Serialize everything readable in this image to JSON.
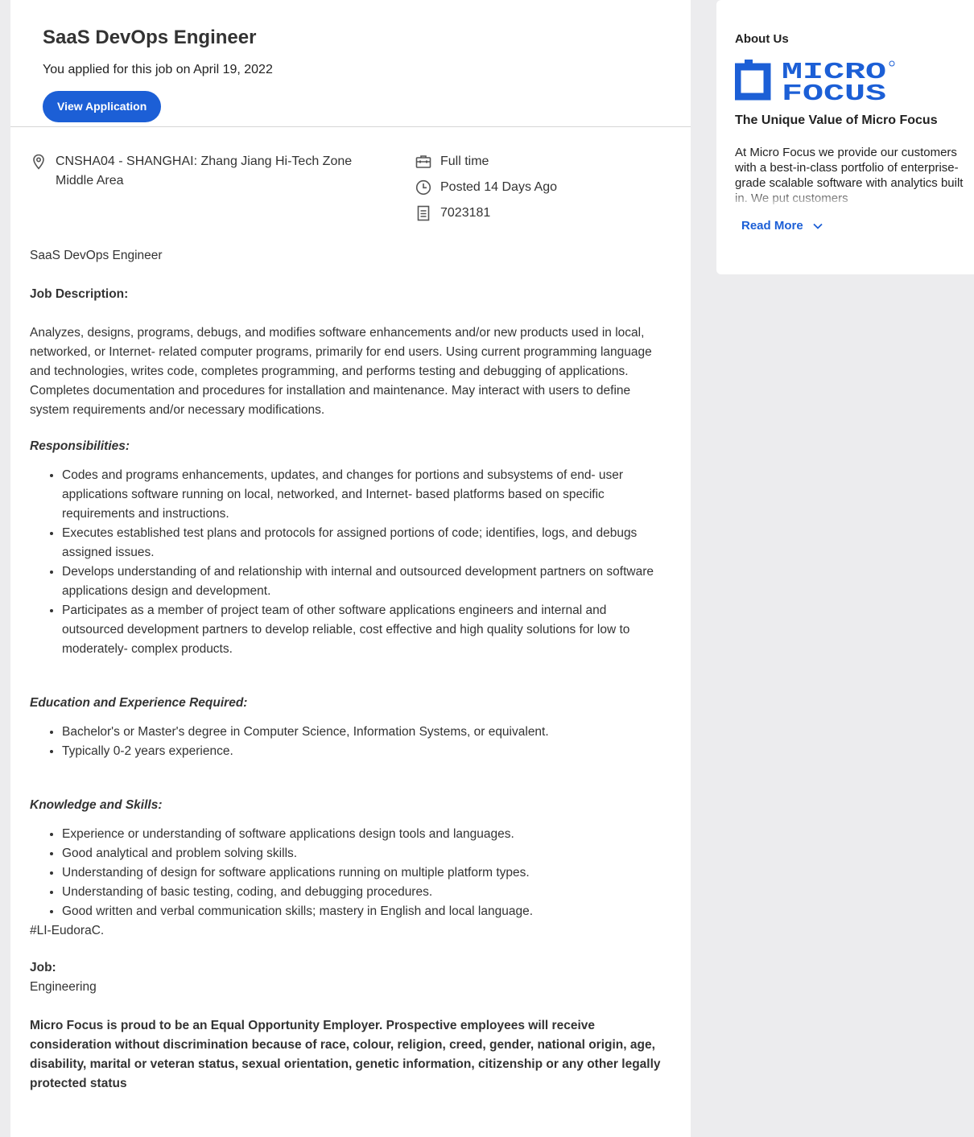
{
  "job": {
    "title": "SaaS DevOps Engineer",
    "applied_text": "You applied for this job on April 19, 2022",
    "view_button": "View Application",
    "location_line1": "CNSHA04 - SHANGHAI: Zhang Jiang Hi-Tech Zone",
    "location_line2": "Middle Area",
    "job_type": "Full time",
    "posted": "Posted 14 Days Ago",
    "req_id": "7023181"
  },
  "description": {
    "intro_title": "SaaS DevOps Engineer",
    "job_desc_label": "Job Description:",
    "job_desc_text": "Analyzes, designs, programs, debugs, and modifies software enhancements and/or new products used in local, networked, or Internet- related computer programs, primarily for end users. Using current programming language and technologies, writes code, completes programming, and performs testing and debugging of applications. Completes documentation and procedures for installation and maintenance. May interact with users to define system requirements and/or necessary modifications.",
    "responsibilities_label": "Responsibilities:",
    "responsibilities": [
      "Codes and programs enhancements, updates, and changes for portions and subsystems of end- user applications software running on local, networked, and Internet- based platforms based on specific requirements and instructions.",
      "Executes established test plans and protocols for assigned portions of code; identifies, logs, and debugs assigned issues.",
      "Develops understanding of and relationship with internal and outsourced development partners on software applications design and development.",
      "Participates as a member of project team of other software applications engineers and internal and outsourced development partners to develop reliable, cost effective and high quality solutions for low to moderately- complex products."
    ],
    "education_label": "Education and Experience Required:",
    "education": [
      "Bachelor's or Master's degree in Computer Science, Information Systems, or equivalent.",
      "Typically 0-2 years experience."
    ],
    "skills_label": "Knowledge and Skills:",
    "skills": [
      "Experience or understanding of software applications design tools and languages.",
      "Good analytical and problem solving skills.",
      "Understanding of design for software applications running on multiple platform types.",
      "Understanding of basic testing, coding, and debugging procedures.",
      "Good written and verbal communication skills; mastery in English and local language."
    ],
    "hashtag": "#LI-EudoraC.",
    "job_label": "Job:",
    "job_value": "Engineering",
    "eeo": "Micro Focus is proud to be an  Equal Opportunity Employer.  Prospective employees will receive consideration without discrimination because of race, colour, religion, creed, gender, national origin, age, disability, marital or veteran status, sexual orientation, genetic information, citizenship or any other legally protected status"
  },
  "sidebar": {
    "about_label": "About Us",
    "logo_text_line1": "MICRO",
    "logo_text_line2": "FOCUS",
    "value_title": "The Unique Value of Micro Focus",
    "about_text": "At Micro Focus we provide our customers with a best-in-class portfolio of enterprise-grade scalable software with analytics built in. We put customers",
    "read_more": "Read More"
  },
  "colors": {
    "accent": "#1c5fd6",
    "page_bg": "#ececee"
  },
  "icons": [
    "location-pin-icon",
    "briefcase-icon",
    "clock-icon",
    "document-icon",
    "chevron-down-icon"
  ]
}
